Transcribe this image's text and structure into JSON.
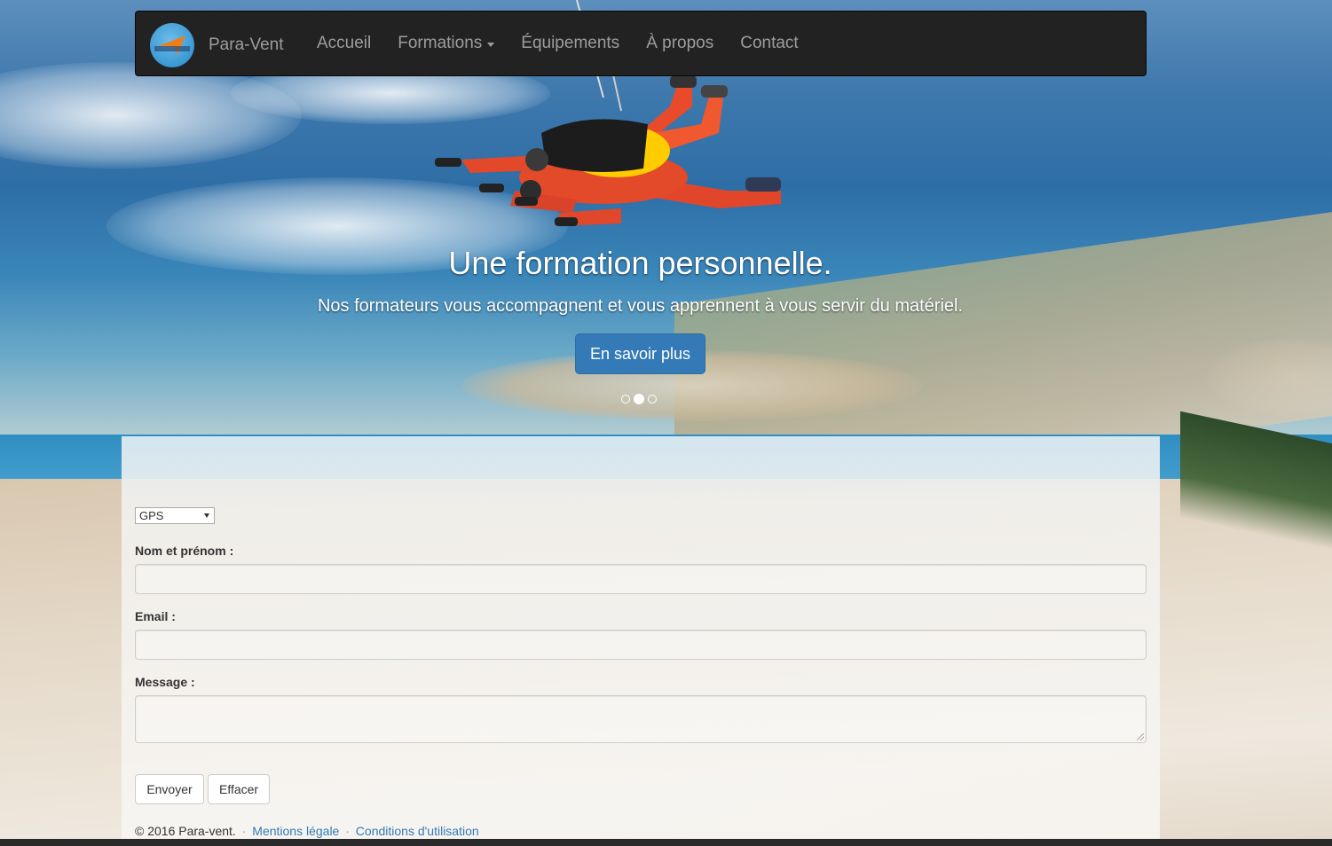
{
  "navbar": {
    "brand_name": "Para-Vent",
    "logo_icon": "parachute-logo-icon",
    "links": [
      {
        "label": "Accueil"
      },
      {
        "label": "Formations",
        "dropdown": true
      },
      {
        "label": "Équipements"
      },
      {
        "label": "À propos"
      },
      {
        "label": "Contact"
      }
    ]
  },
  "hero": {
    "title": "Une formation personnelle.",
    "subtitle": "Nos formateurs vous accompagnent et vous apprennent à vous servir du matériel.",
    "button_label": "En savoir plus",
    "slide_count": 3,
    "active_slide": 2
  },
  "form": {
    "select_value": "GPS",
    "name_label": "Nom et prénom :",
    "email_label": "Email :",
    "message_label": "Message :",
    "submit_label": "Envoyer",
    "reset_label": "Effacer"
  },
  "footer": {
    "copyright": "© 2016 Para-vent.",
    "sep": "·",
    "legal_link": "Mentions légale",
    "terms_link": "Conditions d'utilisation"
  },
  "colors": {
    "navbar_bg": "#222222",
    "nav_text": "#9d9d9d",
    "primary": "#337ab7",
    "link": "#337ab7"
  }
}
